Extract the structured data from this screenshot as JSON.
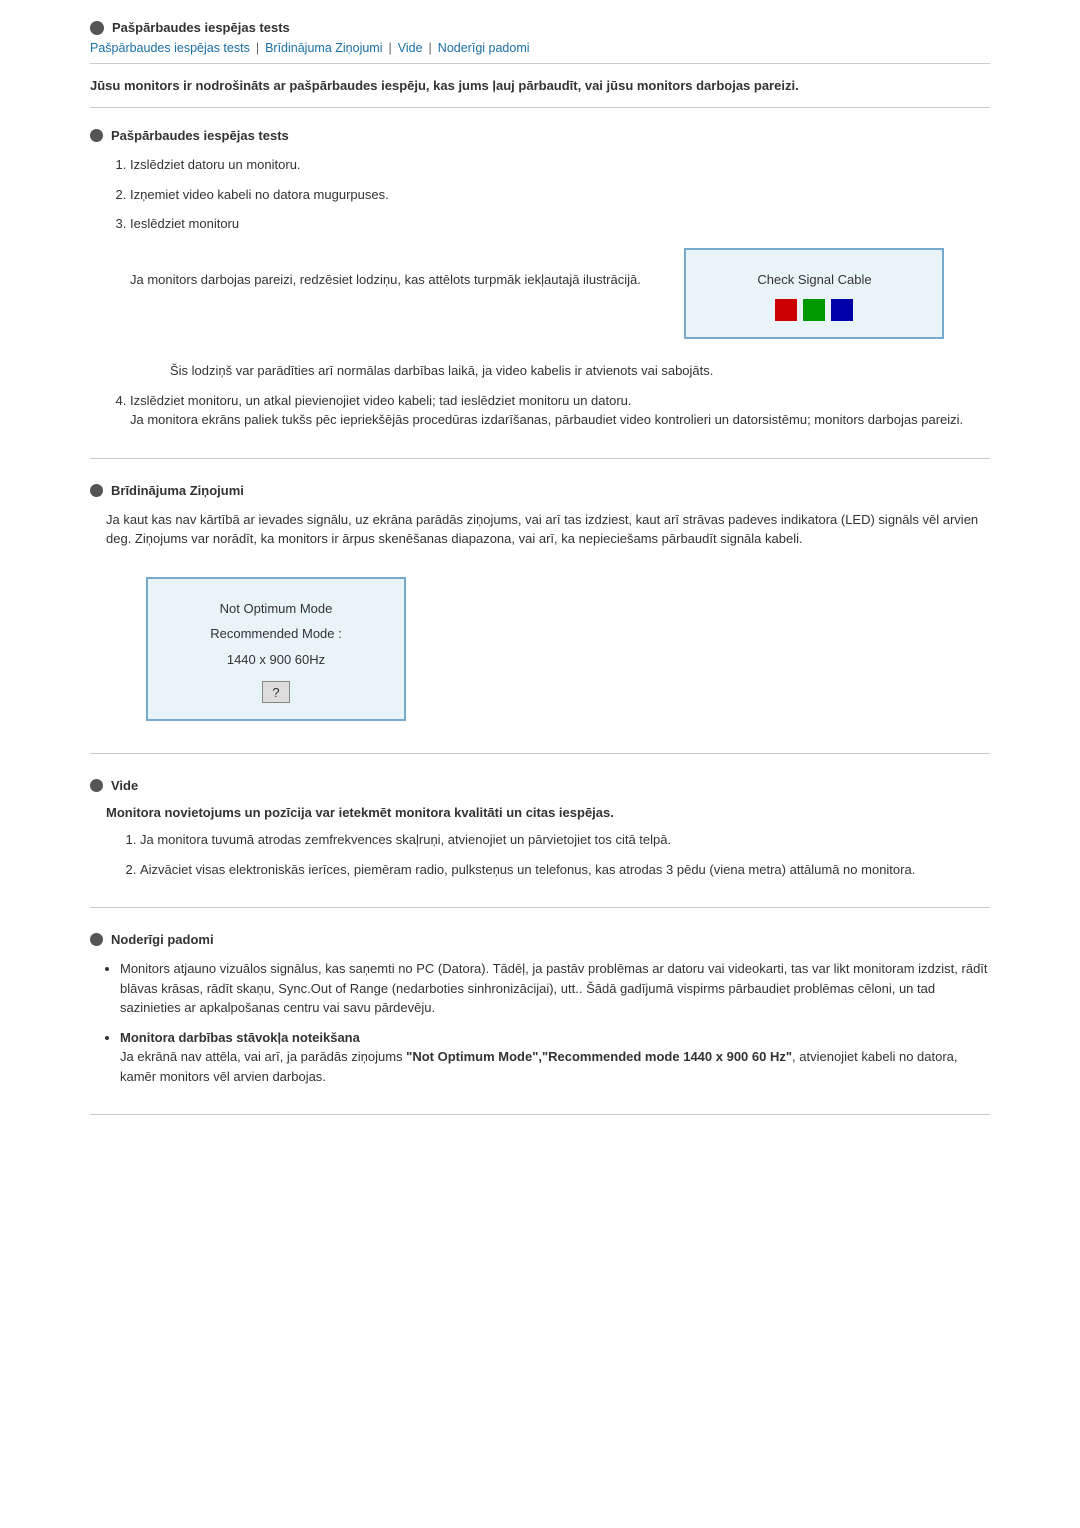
{
  "header": {
    "icon_label": "header-icon",
    "title": "Pašpārbaudes iespējas tests"
  },
  "nav": {
    "items": [
      {
        "label": "Pašpārbaudes iespējas tests",
        "href": "#self-test"
      },
      {
        "label": "Brīdinājuma Ziņojumi",
        "href": "#warnings"
      },
      {
        "label": "Vide",
        "href": "#vide"
      },
      {
        "label": "Noderīgi padomi",
        "href": "#tips"
      }
    ],
    "separators": [
      "|",
      "|",
      "|"
    ]
  },
  "intro": {
    "text": "Jūsu monitors ir nodrošināts ar pašpārbaudes iespēju, kas jums ļauj pārbaudīt, vai jūsu monitors darbojas pareizi."
  },
  "sections": {
    "self_test": {
      "title": "Pašpārbaudes iespējas tests",
      "steps": [
        {
          "id": 1,
          "text": "Izslēdziet datoru un monitoru."
        },
        {
          "id": 2,
          "text": "Izņemiet video kabeli no datora mugurpuses."
        },
        {
          "id": 3,
          "text": "Ieslēdziet monitoru",
          "sub": "Ja monitors darbojas pareizi, redzēsiet lodziņu, kas attēlots turpmāk iekļautajā ilustrācijā.",
          "illustration": {
            "type": "check-signal",
            "message": "Check Signal Cable",
            "squares": [
              "red",
              "green",
              "blue"
            ]
          },
          "note": "Šis lodziņš var parādīties arī normālas darbības laikā, ja video kabelis ir atvienots vai sabojāts."
        },
        {
          "id": 4,
          "text": "Izslēdziet monitoru, un atkal pievienojiet video kabeli; tad ieslēdziet monitoru un datoru.",
          "sub": "Ja monitora ekrāns paliek tukšs pēc iepriekšējās procedūras izdarīšanas, pārbaudiet video kontrolieri un datorsistēmu; monitors darbojas pareizi."
        }
      ]
    },
    "warnings": {
      "title": "Brīdinājuma Ziņojumi",
      "body": "Ja kaut kas nav kārtībā ar ievades signālu, uz ekrāna parādās ziņojums, vai arī tas izdziest, kaut arī strāvas padeves indikatora (LED) signāls vēl arvien deg. Ziņojums var norādīt, ka monitors ir ārpus skenēšanas diapazona, vai arī, ka nepieciešams pārbaudīt signāla kabeli.",
      "illustration": {
        "type": "not-optimum",
        "line1": "Not Optimum Mode",
        "line2": "Recommended Mode :",
        "line3": "1440 x 900 60Hz",
        "button": "?"
      }
    },
    "vide": {
      "title": "Vide",
      "intro": "Monitora novietojums un pozīcija var ietekmēt monitora kvalitāti un citas iespējas.",
      "items": [
        {
          "id": 1,
          "text": "Ja monitora tuvumā atrodas zemfrekvences skaļruņi, atvienojiet un pārvietojiet tos citā telpā."
        },
        {
          "id": 2,
          "text": "Aizvāciet visas elektroniskās ierīces, piemēram radio, pulksteņus un telefonus, kas atrodas 3 pēdu (viena metra) attālumā no monitora."
        }
      ]
    },
    "tips": {
      "title": "Noderīgi padomi",
      "bullets": [
        {
          "text": "Monitors atjauno vizuālos signālus, kas saņemti no PC (Datora). Tādēļ, ja pastāv problēmas ar datoru vai videokarti, tas var likt monitoram izdzist, rādīt blāvas krāsas, rādīt skaņu, Sync.Out of Range (nedarboties sinhronizācijai), utt.. Šādā gadījumā vispirms pārbaudiet problēmas cēloni, un tad sazinieties ar apkalpošanas centru vai savu pārdevēju."
        },
        {
          "label": "Monitora darbības stāvokļa noteikšana",
          "text": "Ja ekrānā nav attēla, vai arī, ja parādās ziņojums",
          "bold_part": "\"Not Optimum Mode\",\"Recommended mode 1440 x 900 60 Hz\"",
          "text2": ", atvienojiet kabeli no datora, kamēr monitors vēl arvien darbojas."
        }
      ]
    }
  }
}
